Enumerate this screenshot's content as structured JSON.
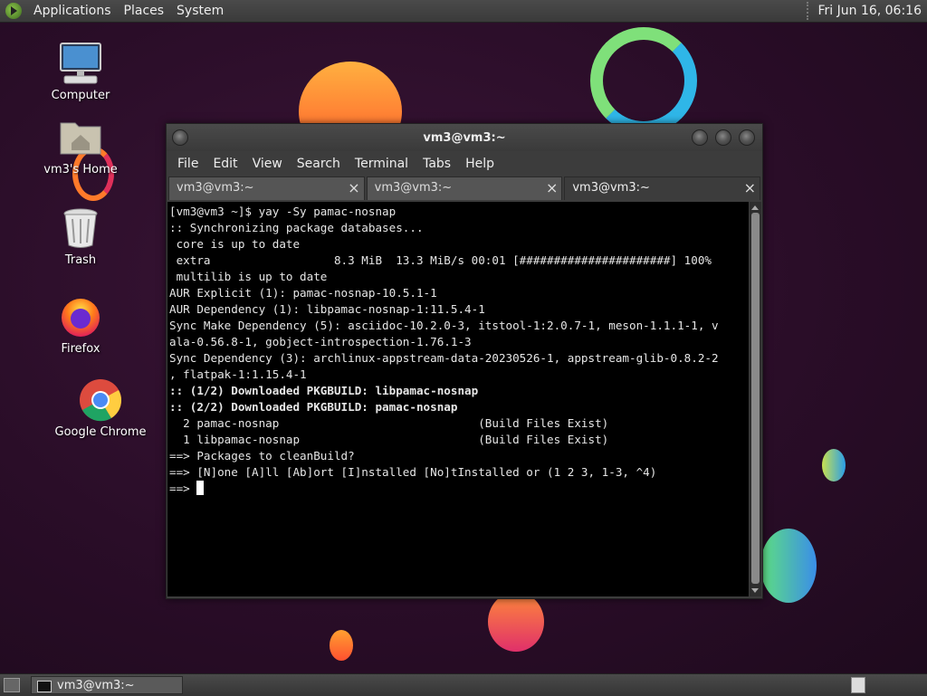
{
  "top_panel": {
    "menus": [
      "Applications",
      "Places",
      "System"
    ],
    "clock": "Fri Jun 16, 06:16"
  },
  "desktop": {
    "icons": [
      {
        "label": "Computer",
        "icon": "computer-icon"
      },
      {
        "label": "vm3's Home",
        "icon": "home-folder-icon"
      },
      {
        "label": "Trash",
        "icon": "trash-icon"
      },
      {
        "label": "Firefox",
        "icon": "firefox-icon"
      },
      {
        "label": "Google Chrome",
        "icon": "chrome-icon"
      }
    ]
  },
  "window": {
    "title": "vm3@vm3:~",
    "menu": [
      "File",
      "Edit",
      "View",
      "Search",
      "Terminal",
      "Tabs",
      "Help"
    ],
    "tabs": [
      {
        "label": "vm3@vm3:~",
        "active": false
      },
      {
        "label": "vm3@vm3:~",
        "active": false
      },
      {
        "label": "vm3@vm3:~",
        "active": true
      }
    ],
    "terminal_lines": [
      {
        "text": "[vm3@vm3 ~]$ yay -Sy pamac-nosnap",
        "bold": false
      },
      {
        "text": ":: Synchronizing package databases...",
        "bold": false
      },
      {
        "text": " core is up to date",
        "bold": false
      },
      {
        "text": " extra                  8.3 MiB  13.3 MiB/s 00:01 [######################] 100%",
        "bold": false
      },
      {
        "text": " multilib is up to date",
        "bold": false
      },
      {
        "text": "AUR Explicit (1): pamac-nosnap-10.5.1-1",
        "bold": false
      },
      {
        "text": "AUR Dependency (1): libpamac-nosnap-1:11.5.4-1",
        "bold": false
      },
      {
        "text": "Sync Make Dependency (5): asciidoc-10.2.0-3, itstool-1:2.0.7-1, meson-1.1.1-1, v",
        "bold": false
      },
      {
        "text": "ala-0.56.8-1, gobject-introspection-1.76.1-3",
        "bold": false
      },
      {
        "text": "Sync Dependency (3): archlinux-appstream-data-20230526-1, appstream-glib-0.8.2-2",
        "bold": false
      },
      {
        "text": ", flatpak-1:1.15.4-1",
        "bold": false
      },
      {
        "text": ":: (1/2) Downloaded PKGBUILD: libpamac-nosnap",
        "bold": true
      },
      {
        "text": ":: (2/2) Downloaded PKGBUILD: pamac-nosnap",
        "bold": true
      },
      {
        "text": "  2 pamac-nosnap                             (Build Files Exist)",
        "bold": false
      },
      {
        "text": "  1 libpamac-nosnap                          (Build Files Exist)",
        "bold": false
      },
      {
        "text": "==> Packages to cleanBuild?",
        "bold": false
      },
      {
        "text": "==> [N]one [A]ll [Ab]ort [I]nstalled [No]tInstalled or (1 2 3, 1-3, ^4)",
        "bold": false
      }
    ],
    "prompt": "==> "
  },
  "bottom_panel": {
    "task_label": "vm3@vm3:~"
  }
}
